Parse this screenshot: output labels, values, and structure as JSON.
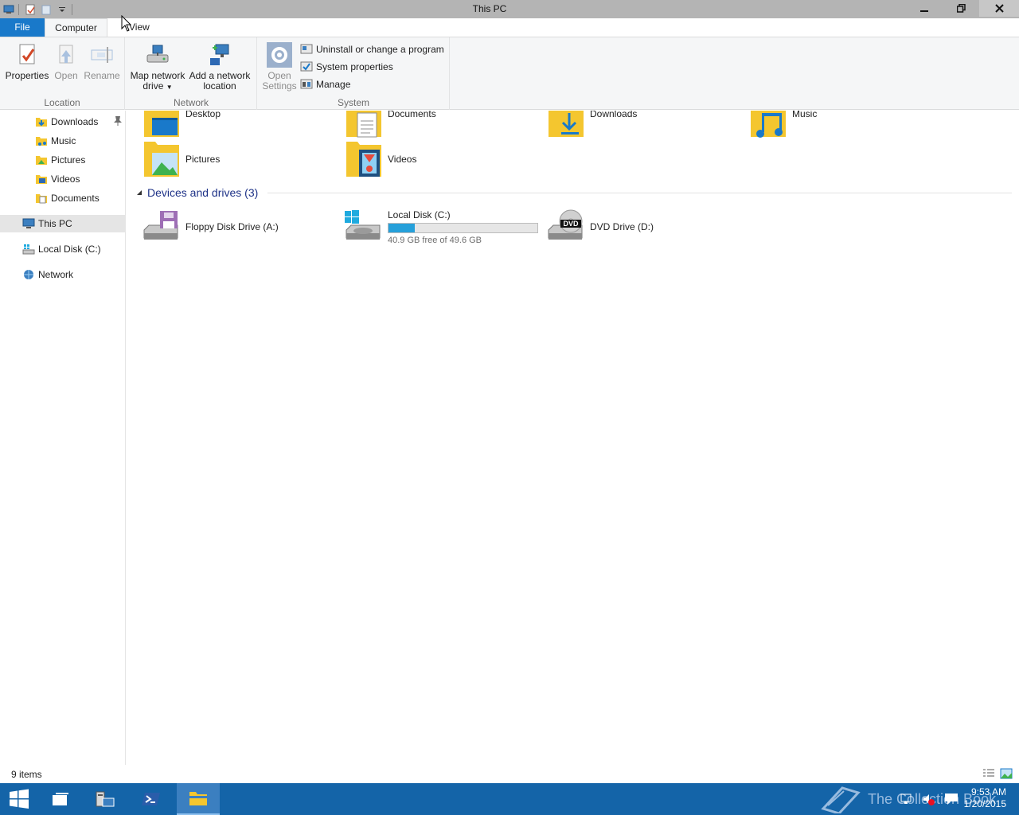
{
  "window": {
    "title": "This PC",
    "controls": {
      "minimize": "minimize",
      "restore": "restore",
      "close": "close"
    }
  },
  "tabs": {
    "file": "File",
    "computer": "Computer",
    "view": "View"
  },
  "ribbon": {
    "location": {
      "label": "Location",
      "properties": "Properties",
      "open": "Open",
      "rename": "Rename"
    },
    "network": {
      "label": "Network",
      "map_drive_line1": "Map network",
      "map_drive_line2": "drive",
      "add_location_line1": "Add a network",
      "add_location_line2": "location"
    },
    "system": {
      "label": "System",
      "open_settings_line1": "Open",
      "open_settings_line2": "Settings",
      "uninstall": "Uninstall or change a program",
      "system_properties": "System properties",
      "manage": "Manage"
    }
  },
  "nav": {
    "items": [
      {
        "label": "Downloads",
        "icon": "downloads-folder-icon",
        "pinned": true
      },
      {
        "label": "Music",
        "icon": "music-folder-icon"
      },
      {
        "label": "Pictures",
        "icon": "pictures-folder-icon"
      },
      {
        "label": "Videos",
        "icon": "videos-folder-icon"
      },
      {
        "label": "Documents",
        "icon": "documents-folder-icon"
      },
      {
        "label": "This PC",
        "icon": "computer-icon",
        "selected": true
      },
      {
        "label": "Local Disk (C:)",
        "icon": "drive-icon"
      },
      {
        "label": "Network",
        "icon": "network-icon"
      }
    ]
  },
  "folders": [
    {
      "label": "Desktop"
    },
    {
      "label": "Documents"
    },
    {
      "label": "Downloads"
    },
    {
      "label": "Music"
    },
    {
      "label": "Pictures"
    },
    {
      "label": "Videos"
    }
  ],
  "devices": {
    "header": "Devices and drives (3)",
    "drives": [
      {
        "label": "Floppy Disk Drive (A:)"
      },
      {
        "label": "Local Disk (C:)",
        "free_text": "40.9 GB free of 49.6 GB",
        "used_fraction": 0.175
      },
      {
        "label": "DVD Drive (D:)",
        "badge": "DVD"
      }
    ]
  },
  "status": {
    "items": "9 items"
  },
  "taskbar": {
    "watermark": "The Collection Book",
    "time": "9:53 AM",
    "date": "1/20/2015"
  },
  "colors": {
    "accent": "#1979ca",
    "taskbar": "#1464a8",
    "progress": "#26a0da"
  }
}
